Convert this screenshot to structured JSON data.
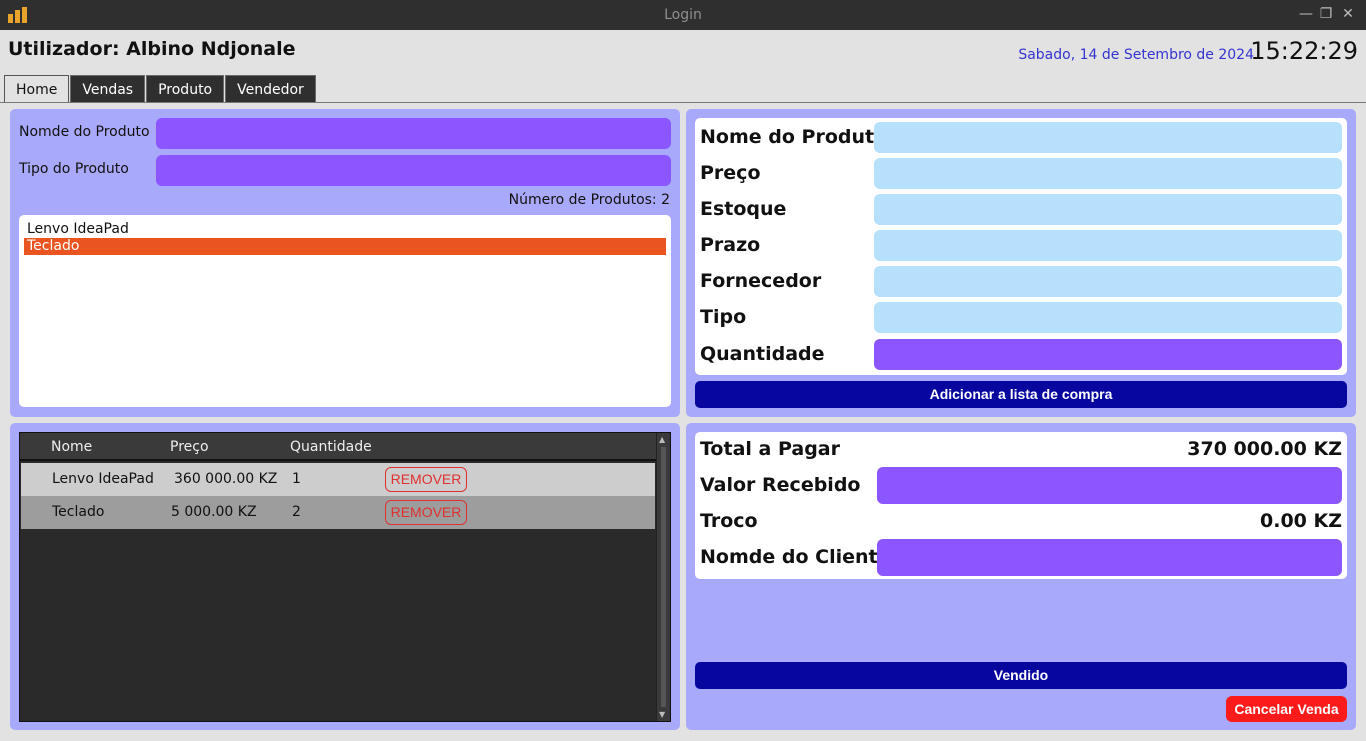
{
  "window": {
    "title": "Login",
    "controls": {
      "minimize": "—",
      "restore": "❐",
      "close": "✕"
    },
    "icon": "bar-chart-icon"
  },
  "header": {
    "user": "Utilizador: Albino Ndjonale",
    "date": "Sabado, 14 de Setembro de 2024",
    "time": "15:22:29"
  },
  "tabs": [
    "Home",
    "Vendas",
    "Produto",
    "Vendedor"
  ],
  "filter": {
    "name_label": "Nomde do Produto",
    "type_label": "Tipo do Produto",
    "name_value": "",
    "type_value": "",
    "count_label": "Número de Produtos: 2",
    "products": [
      {
        "name": "Lenvo IdeaPad",
        "selected": false
      },
      {
        "name": "Teclado",
        "selected": true
      }
    ]
  },
  "detail": {
    "labels": [
      "Nome do Produto",
      "Preço",
      "Estoque",
      "Prazo",
      "Fornecedor",
      "Tipo",
      "Quantidade"
    ],
    "add_button": "Adicionar a lista de compra"
  },
  "cart": {
    "columns": [
      "Nome",
      "Preço",
      "Quantidade"
    ],
    "rows": [
      {
        "name": "Lenvo IdeaPad",
        "price": "360 000.00 KZ",
        "qty": "1",
        "action": "REMOVER"
      },
      {
        "name": "Teclado",
        "price": "5 000.00 KZ",
        "qty": "2",
        "action": "REMOVER"
      }
    ]
  },
  "payment": {
    "total_label": "Total a Pagar",
    "total_value": "370 000.00 KZ",
    "received_label": "Valor Recebido",
    "change_label": "Troco",
    "change_value": "0.00 KZ",
    "client_label": "Nomde do Cliente",
    "sold_button": "Vendido",
    "cancel_button": "Cancelar Venda"
  },
  "colors": {
    "panel": "#a9a9fb",
    "input_purple": "#8b55ff",
    "input_blue": "#b6e0fc",
    "button_navy": "#0707a0",
    "cancel_red": "#fb1b1b",
    "selection": "#e95420",
    "date_text": "#3434d0"
  }
}
